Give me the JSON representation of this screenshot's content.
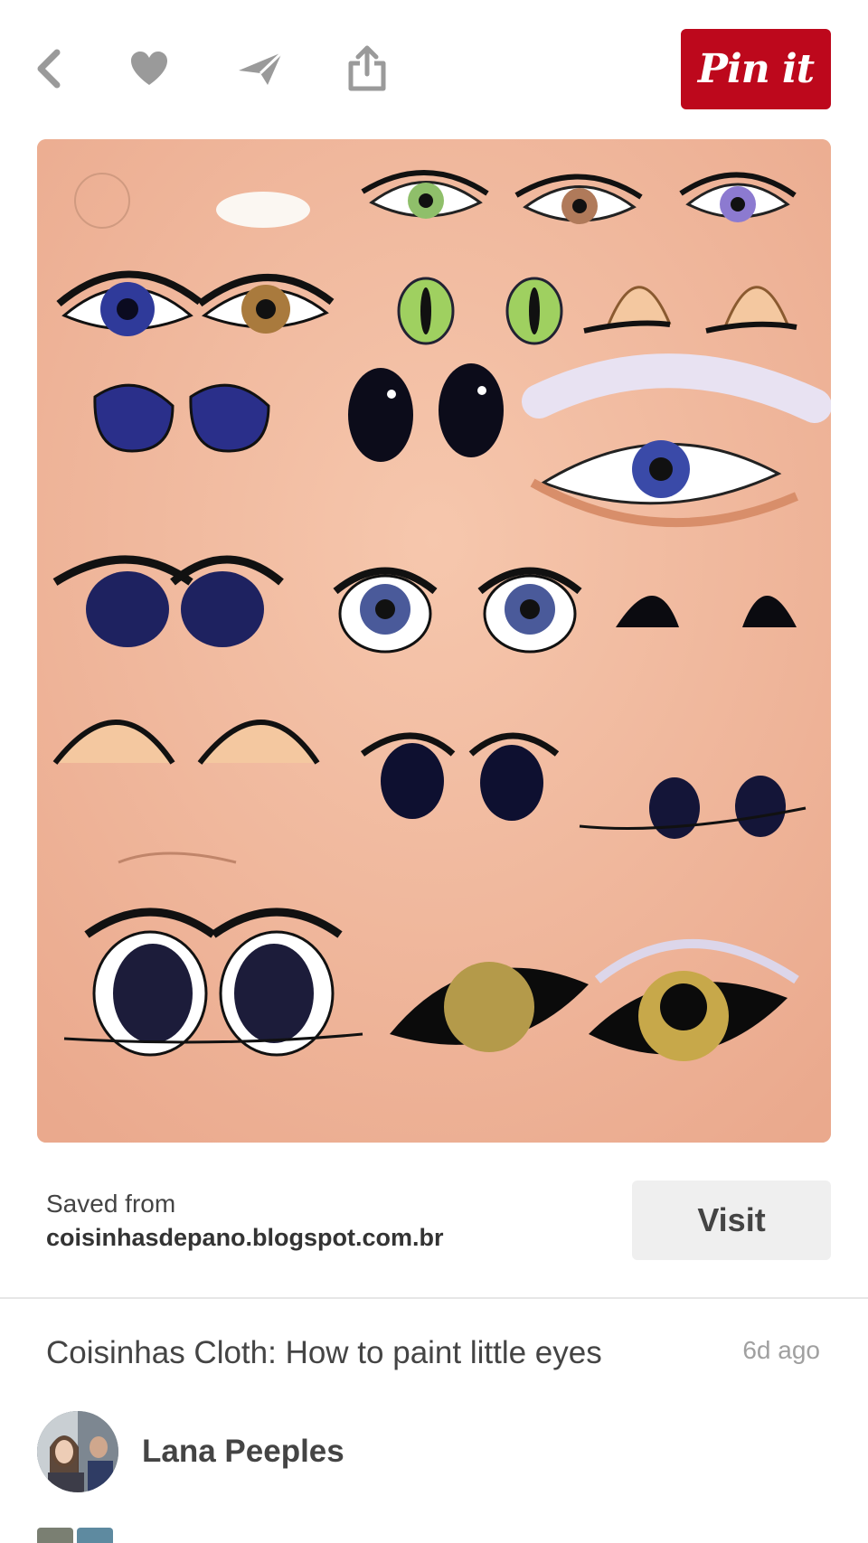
{
  "toolbar": {
    "icons": [
      "back-icon",
      "heart-icon",
      "send-icon",
      "share-icon"
    ],
    "pin_button_label": "Pin it",
    "pin_button_color": "#bd081c"
  },
  "pin": {
    "image_description": "eye painting reference sheet",
    "background_color": "#f0b79c"
  },
  "source": {
    "saved_from_label": "Saved from",
    "url": "coisinhasdepano.blogspot.com.br",
    "visit_label": "Visit"
  },
  "details": {
    "title": "Coisinhas Cloth: How to paint little eyes",
    "timestamp": "6d ago"
  },
  "user": {
    "name": "Lana Peeples"
  }
}
